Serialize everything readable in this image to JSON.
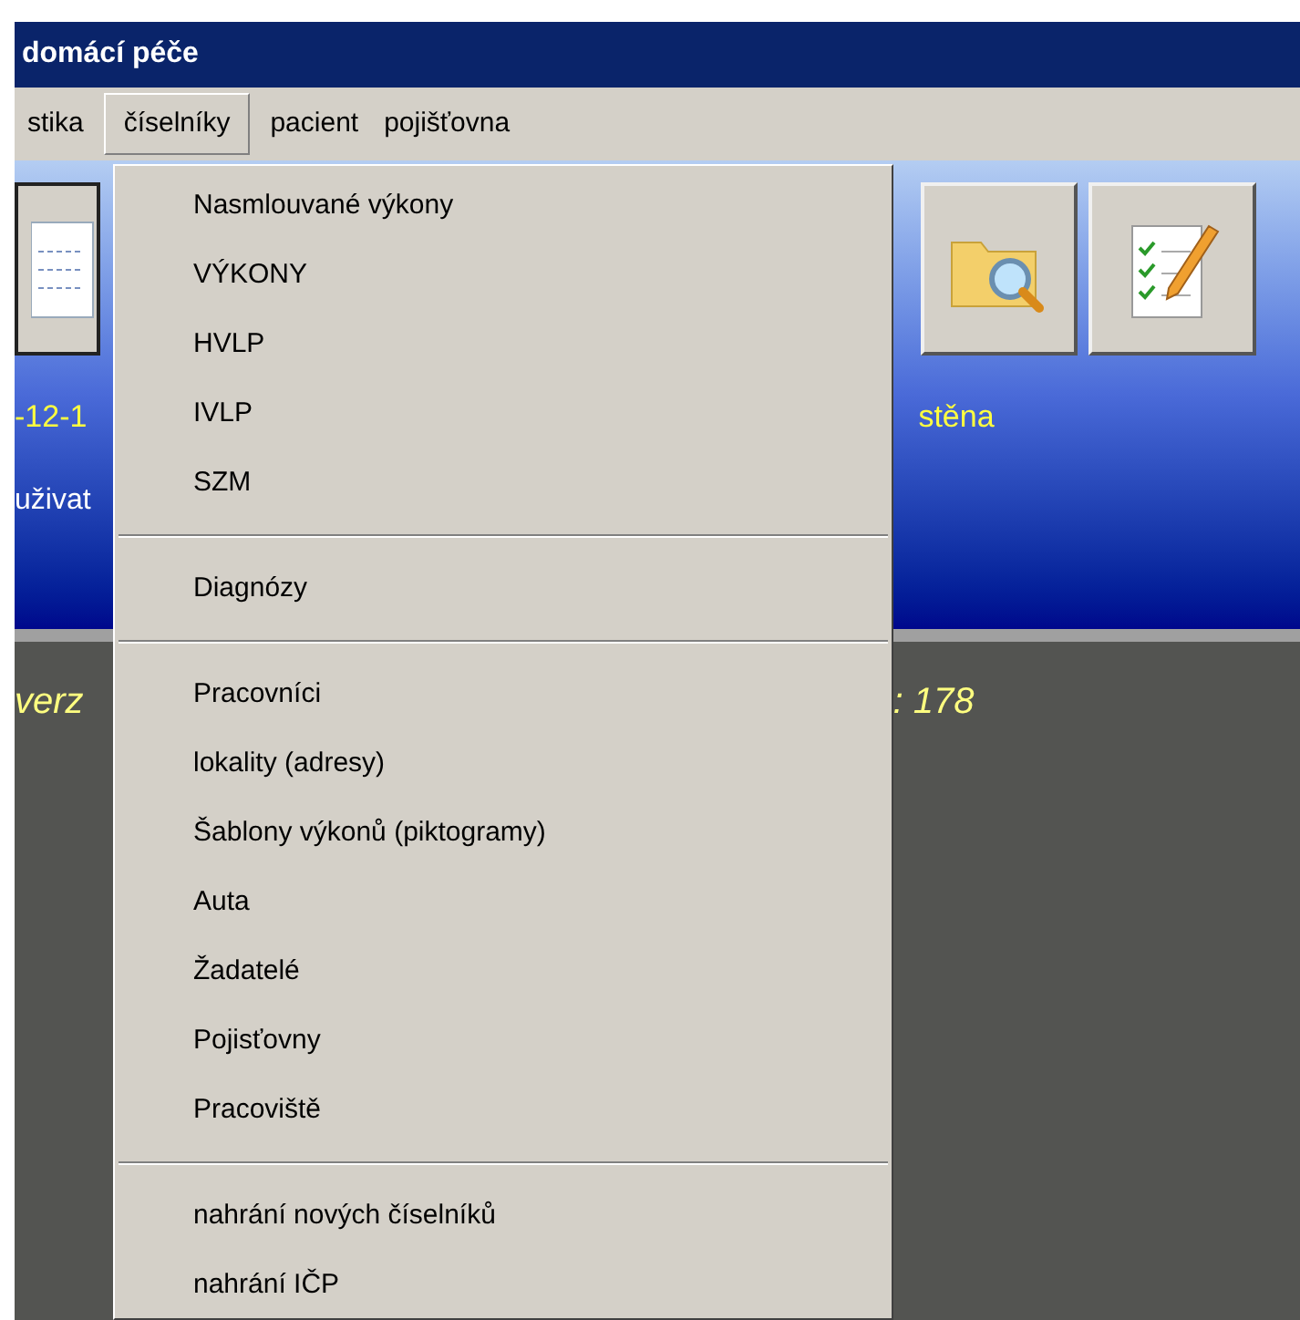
{
  "window": {
    "title": "domácí péče"
  },
  "menu_bar": [
    {
      "label": "stika",
      "selected": false
    },
    {
      "label": "číselníky",
      "selected": true
    },
    {
      "label": "pacient",
      "selected": false
    },
    {
      "label": "pojišťovna",
      "selected": false
    }
  ],
  "dropdown": [
    {
      "kind": "item",
      "label": "Nasmlouvané výkony"
    },
    {
      "kind": "item",
      "label": "VÝKONY"
    },
    {
      "kind": "item",
      "label": "HVLP"
    },
    {
      "kind": "item",
      "label": "IVLP"
    },
    {
      "kind": "item",
      "label": "SZM"
    },
    {
      "kind": "separator"
    },
    {
      "kind": "item",
      "label": "Diagnózy"
    },
    {
      "kind": "separator"
    },
    {
      "kind": "item",
      "label": "Pracovníci"
    },
    {
      "kind": "item",
      "label": "lokality (adresy)"
    },
    {
      "kind": "item",
      "label": "Šablony výkonů (piktogramy)"
    },
    {
      "kind": "item",
      "label": "Auta"
    },
    {
      "kind": "item",
      "label": "Žadatelé"
    },
    {
      "kind": "item",
      "label": "Pojisťovny"
    },
    {
      "kind": "item",
      "label": "Pracoviště"
    },
    {
      "kind": "separator"
    },
    {
      "kind": "item",
      "label": "nahrání nových číselníků"
    },
    {
      "kind": "item",
      "label": "nahrání IČP"
    }
  ],
  "info_panel": {
    "date": "-12-1",
    "location": "stěna",
    "user": "uživat"
  },
  "status_area": {
    "version": "verz",
    "count": ": 178"
  }
}
